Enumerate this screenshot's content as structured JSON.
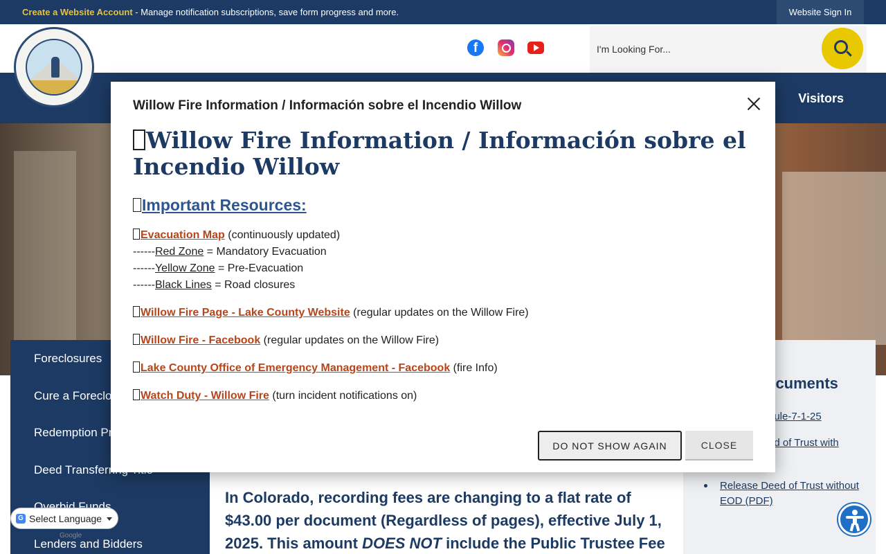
{
  "topbar": {
    "create_link": "Create a Website Account",
    "create_desc": " - Manage notification subscriptions, save form progress and more.",
    "sign_in": "Website Sign In"
  },
  "header": {
    "search_placeholder": "I'm Looking For...",
    "social": [
      "facebook-icon",
      "instagram-icon",
      "youtube-icon"
    ]
  },
  "nav": {
    "visitors": "Visitors"
  },
  "sidebar": {
    "items": [
      "Foreclosures",
      "Cure a Foreclos",
      "Redemption Pr",
      "Deed Transferring Title",
      "Overbid Funds",
      "Lenders and Bidders"
    ]
  },
  "content": {
    "notice_part1": "In Colorado, recording fees are changing to a flat rate of $43.00 per document (Regardless of pages), effective July 1, 2025. This amount ",
    "notice_em": "DOES NOT",
    "notice_part2": " include the Public Trustee Fee"
  },
  "rightcol": {
    "title": "ocuments",
    "link1": "dule-7-1-25",
    "link2": "ed of Trust with",
    "link3": "Release Deed of Trust without EOD (PDF)"
  },
  "translate": {
    "label": "Select Language",
    "powered": "Google"
  },
  "modal": {
    "title": "Willow Fire Information / Información sobre el Incendio Willow",
    "heading": "Willow Fire Information / Información sobre el Incendio Willow",
    "subheading": "Important Resources:",
    "evac_link": "Evacuation Map",
    "evac_note": " (continuously updated)",
    "dash": "------",
    "red_zone": "Red Zone",
    "red_desc": " = Mandatory Evacuation",
    "yellow_zone": "Yellow Zone",
    "yellow_desc": " = Pre-Evacuation",
    "black_lines": "Black Lines",
    "black_desc": " = Road closures",
    "link_page": "Willow Fire Page - Lake County Website",
    "link_page_note": " (regular updates on the Willow Fire)",
    "link_fb": "Willow Fire - Facebook",
    "link_fb_note": " (regular updates on the Willow Fire)",
    "link_oem": "Lake County Office of Emergency Management - Facebook",
    "link_oem_note": " (fire Info)",
    "link_duty": "Watch Duty - Willow Fire",
    "link_duty_note": " (turn incident notifications on)",
    "btn_dnsa": "DO NOT SHOW AGAIN",
    "btn_close": "CLOSE"
  },
  "colors": {
    "navy": "#1c3a63",
    "gold": "#e8c800",
    "link_orange": "#b5461b"
  }
}
